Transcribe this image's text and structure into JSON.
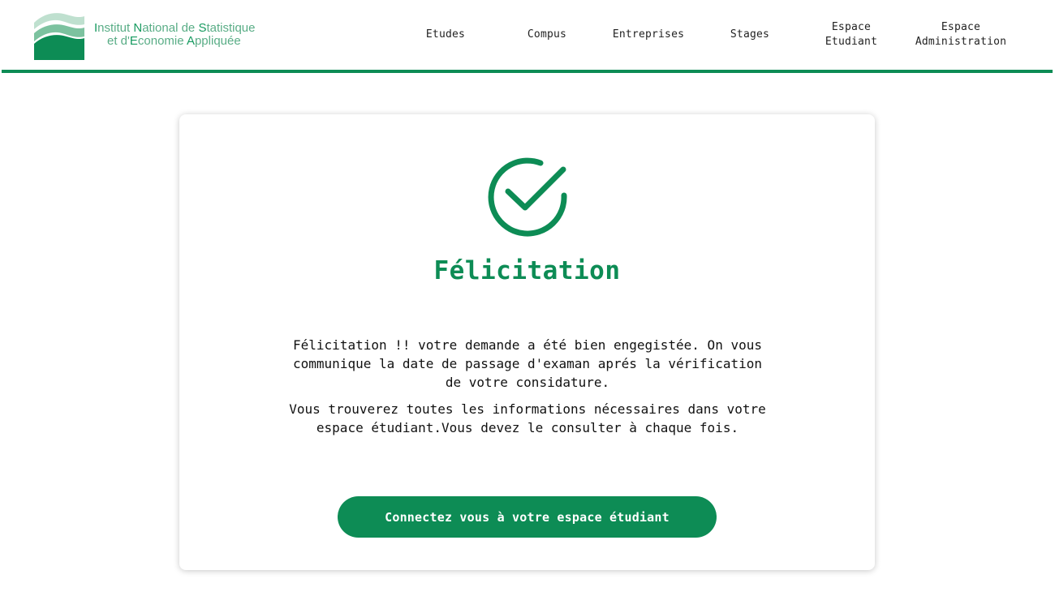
{
  "header": {
    "logo": {
      "icon": "institution-wave-logo",
      "line1_parts": [
        "I",
        "nstitut ",
        "N",
        "ational de ",
        "S",
        "tatistique"
      ],
      "line2_parts": [
        "et d'",
        "E",
        "conomie ",
        "A",
        "ppliquée"
      ]
    },
    "nav": [
      {
        "label": "Etudes"
      },
      {
        "label": "Compus"
      },
      {
        "label": "Entreprises"
      },
      {
        "label": "Stages"
      },
      {
        "label": "Espace\nEtudiant"
      },
      {
        "label": "Espace\nAdministration"
      }
    ],
    "accent_color": "#0d8c55"
  },
  "card": {
    "icon": "check-circle-icon",
    "title": "Félicitation",
    "paragraph1": "Félicitation !! votre demande a été bien engegistée. On vous communique la date de passage d'examan aprés la vérification de votre considature.",
    "paragraph2": "Vous trouverez toutes les informations nécessaires dans votre espace étudiant.Vous devez le consulter à chaque fois.",
    "button_label": "Connectez vous à votre espace étudiant",
    "accent_color": "#0d8c55"
  }
}
